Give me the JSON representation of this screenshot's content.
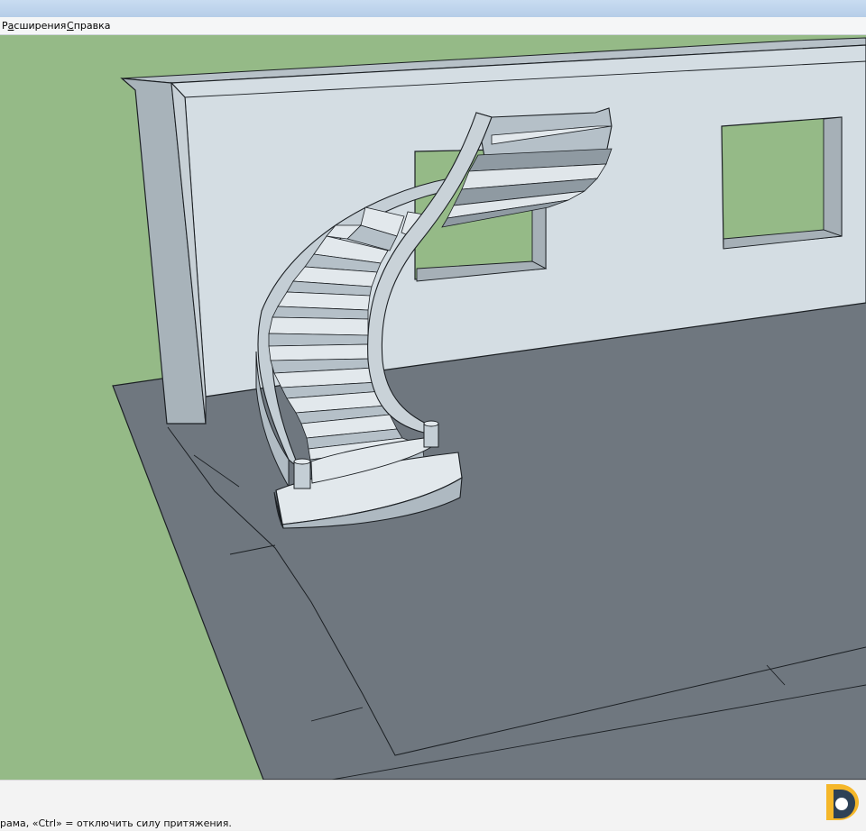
{
  "menu": {
    "items": [
      {
        "label_pre": "Р",
        "label_under": "а",
        "label_post": "сширения"
      },
      {
        "label_pre": "",
        "label_under": "С",
        "label_post": "правка"
      }
    ]
  },
  "statusbar": {
    "hint": "рама, «Ctrl» = отключить силу притяжения."
  },
  "colors": {
    "sky": "#95ba87",
    "wall": "#d3dce2",
    "wall_edge": "#aab4bb",
    "floor": "#707880",
    "floor_border": "#676e75",
    "stair_tread": "#e2e8ec",
    "stair_riser": "#b5c0c8",
    "stringer": "#c4ced5",
    "outline": "#1c2024"
  },
  "icons": {
    "logo": "brand-logo-icon"
  }
}
